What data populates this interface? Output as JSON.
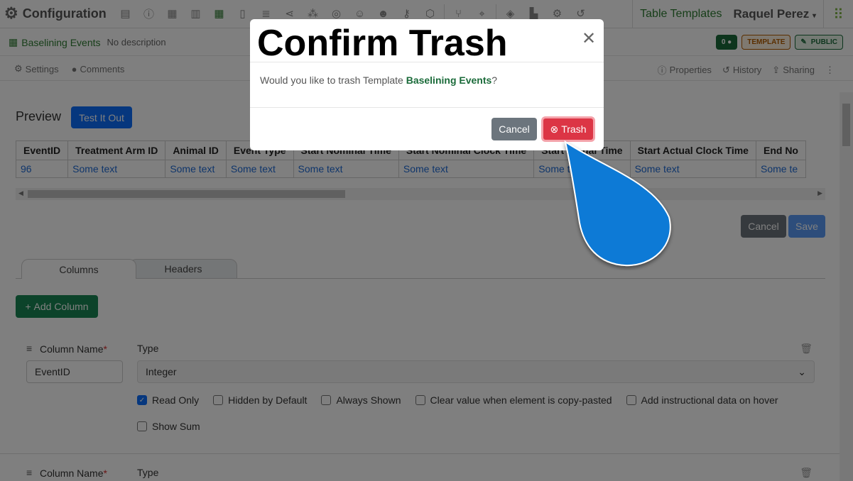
{
  "topnav": {
    "app_title": "Configuration",
    "table_templates_link": "Table Templates",
    "user_name": "Raquel Perez",
    "user_caret": "▾"
  },
  "subheader": {
    "template_name": "Baselining Events",
    "description": "No description",
    "comment_count": "0",
    "template_badge": "TEMPLATE",
    "public_badge": "PUBLIC"
  },
  "toolbar": {
    "settings": "Settings",
    "comments": "Comments",
    "properties": "Properties",
    "history": "History",
    "sharing": "Sharing"
  },
  "preview": {
    "title": "Preview",
    "test_button": "Test It Out",
    "columns": [
      "EventID",
      "Treatment Arm ID",
      "Animal ID",
      "Event Type",
      "Start Nominal Time",
      "Start Nominal Clock Time",
      "Start Actual Time",
      "Start Actual Clock Time",
      "End No"
    ],
    "row": [
      "96",
      "Some text",
      "Some text",
      "Some text",
      "Some text",
      "Some text",
      "Some text",
      "Some text",
      "Some te"
    ],
    "cancel_button": "Cancel",
    "save_button": "Save"
  },
  "tabs": {
    "columns": "Columns",
    "headers": "Headers"
  },
  "add_column_button": "Add Column",
  "column_editor": [
    {
      "name_label": "Column Name",
      "required_mark": "*",
      "type_label": "Type",
      "name_value": "EventID",
      "type_value": "Integer",
      "checkboxes": [
        {
          "label": "Read Only",
          "checked": true
        },
        {
          "label": "Hidden by Default",
          "checked": false
        },
        {
          "label": "Always Shown",
          "checked": false
        },
        {
          "label": "Clear value when element is copy-pasted",
          "checked": false
        },
        {
          "label": "Add instructional data on hover",
          "checked": false
        }
      ],
      "show_sum": {
        "label": "Show Sum",
        "checked": false
      }
    },
    {
      "name_label": "Column Name",
      "required_mark": "*",
      "type_label": "Type"
    }
  ],
  "modal": {
    "title": "Confirm Trash",
    "body_prefix": "Would you like to trash Template ",
    "body_name": "Baselining Events",
    "body_suffix": "?",
    "cancel_button": "Cancel",
    "trash_button": "Trash"
  },
  "colors": {
    "brand_green": "#2e7d32",
    "primary_blue": "#0d6efd",
    "danger_red": "#dc3545",
    "pointer_blue": "#0a7ad6"
  }
}
